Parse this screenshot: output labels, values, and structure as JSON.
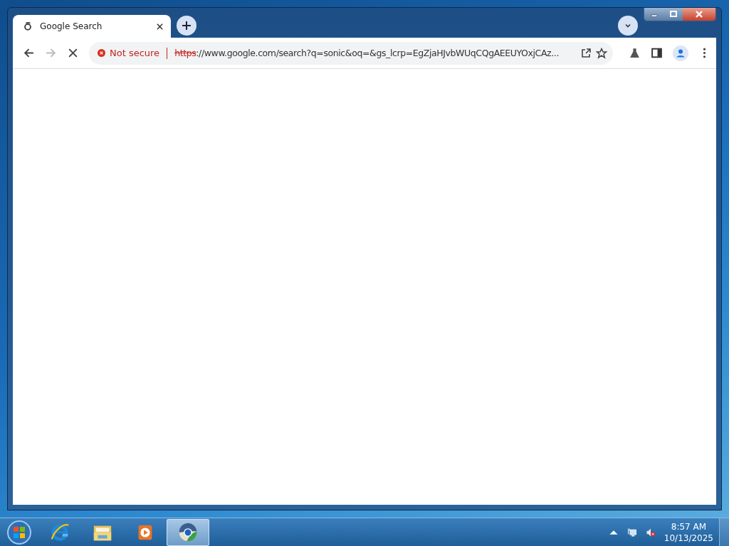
{
  "browser": {
    "tabs": [
      {
        "title": "Google Search",
        "selected": true
      }
    ],
    "nav": {
      "back_disabled": false,
      "forward_disabled": true,
      "loading": true
    },
    "address": {
      "security_label": "Not secure",
      "scheme": "https",
      "scheme_struck": true,
      "url_rest": "://www.google.com/search?q=sonic&oq=&gs_lcrp=EgZjaHJvbWUqCQgAEEUYOxjCAz..."
    }
  },
  "taskbar": {
    "apps": [
      {
        "kind": "ie",
        "selected": false
      },
      {
        "kind": "folder",
        "selected": false
      },
      {
        "kind": "media",
        "selected": false
      },
      {
        "kind": "browser",
        "selected": true
      }
    ],
    "tray": {
      "muted": true,
      "time": "8:57 AM",
      "date": "10/13/2025"
    }
  }
}
